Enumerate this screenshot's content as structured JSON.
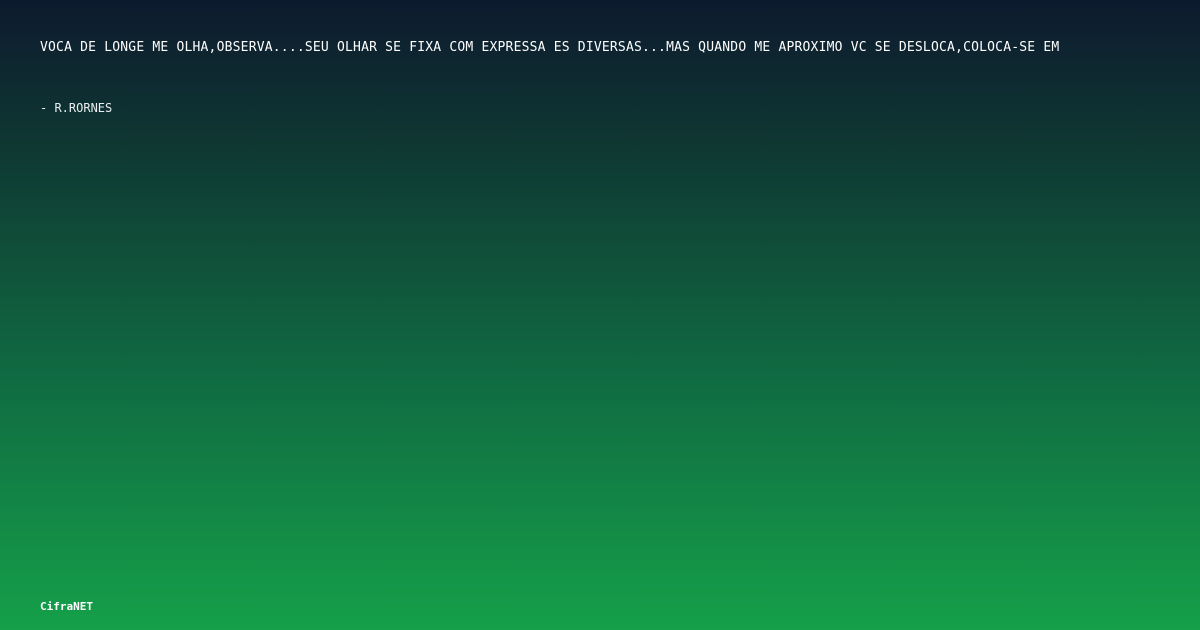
{
  "quote": {
    "text": "VOCÃ  DE LONGE ME OLHA,OBSERVA....SEU OLHAR SE FIXA COM EXPRESSÃ ES DIVERSAS...MAS QUANDO ME APROXIMO VC SE DESLOCA,COLOCA-SE EM",
    "author": "- R.RORNES"
  },
  "footer": {
    "brand": "CifraNET"
  },
  "colors": {
    "background_top": "#0d1a2e",
    "background_bottom": "#15a049",
    "text": "#ffffff"
  }
}
